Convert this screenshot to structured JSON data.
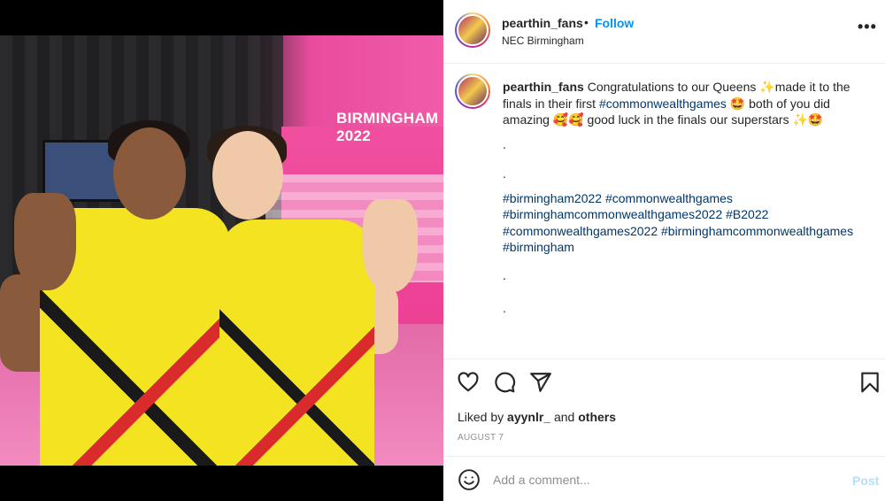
{
  "post": {
    "username": "pearthin_fans",
    "separator": "•",
    "follow_label": "Follow",
    "location": "NEC Birmingham",
    "more_label": "•••"
  },
  "media": {
    "banner_text": "BIRMINGHAM 2022"
  },
  "caption": {
    "username": "pearthin_fans",
    "text_1": "Congratulations to our Queens ✨made it to the finals in their first ",
    "hashtag_1": "#commonwealthgames",
    "text_2": " 🤩 both of you did amazing 🥰🥰 good luck in the finals our superstars ✨🤩",
    "dots": [
      ".",
      "."
    ],
    "hashtags": [
      "#birmingham2022",
      "#commonwealthgames",
      "#birminghamcommonwealthgames2022",
      "#B2022",
      "#commonwealthgames2022",
      "#birminghamcommonwealthgames",
      "#birmingham"
    ],
    "trailing_dots": [
      ".",
      "."
    ]
  },
  "actions": {
    "liked_by_prefix": "Liked by ",
    "liked_by_user": "ayynlr_",
    "liked_by_mid": " and ",
    "liked_by_others": "others",
    "date": "AUGUST 7"
  },
  "comment": {
    "placeholder": "Add a comment...",
    "post_label": "Post"
  },
  "icons": {
    "like": "heart-icon",
    "comment": "comment-icon",
    "share": "share-icon",
    "save": "bookmark-icon",
    "emoji": "emoji-icon"
  },
  "colors": {
    "accent": "#0095f6",
    "hashtag": "#00376b",
    "muted": "#8e8e8e",
    "post_disabled": "#b2dffc"
  }
}
